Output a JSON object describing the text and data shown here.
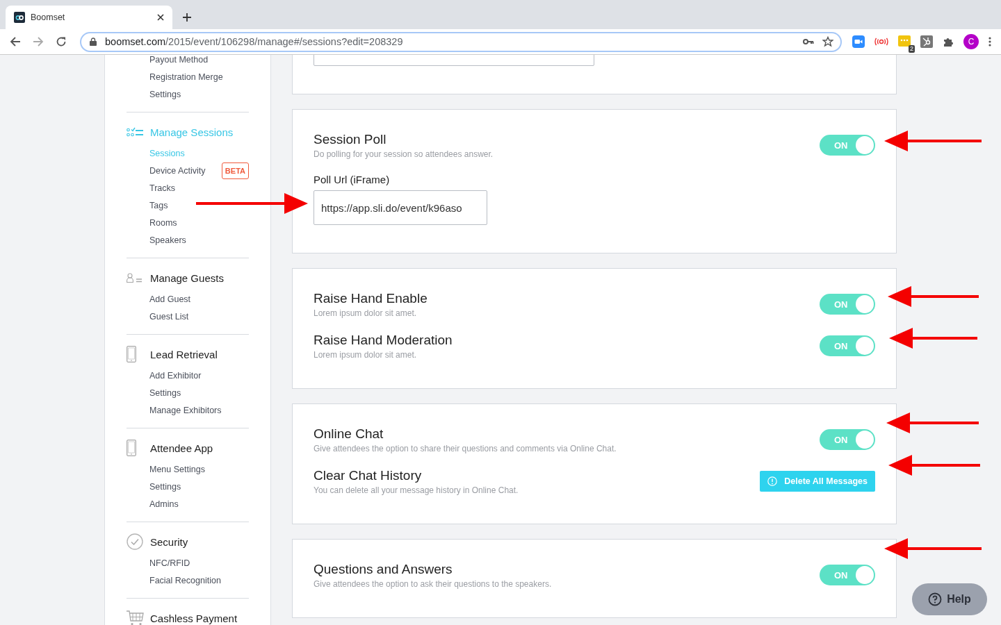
{
  "browser": {
    "tabs": [
      {
        "title": "Boomset",
        "selected": true
      }
    ],
    "address": {
      "host": "boomset.com",
      "path": "/2015/event/106298/manage#/sessions?edit=208329"
    },
    "extension_badge": "2",
    "profile_initial": "C"
  },
  "sidebar": {
    "sections": [
      {
        "items": [
          {
            "label": "Payout Method",
            "selected": false
          },
          {
            "label": "Registration Merge",
            "selected": false
          },
          {
            "label": "Settings",
            "selected": false
          }
        ]
      },
      {
        "title": "Manage Sessions",
        "active": true,
        "items": [
          {
            "label": "Sessions",
            "selected": true
          },
          {
            "label": "Device Activity",
            "selected": false,
            "badge": "BETA"
          },
          {
            "label": "Tracks",
            "selected": false
          },
          {
            "label": "Tags",
            "selected": false
          },
          {
            "label": "Rooms",
            "selected": false
          },
          {
            "label": "Speakers",
            "selected": false
          }
        ]
      },
      {
        "title": "Manage Guests",
        "active": false,
        "items": [
          {
            "label": "Add Guest",
            "selected": false
          },
          {
            "label": "Guest List",
            "selected": false
          }
        ]
      },
      {
        "title": "Lead Retrieval",
        "active": false,
        "items": [
          {
            "label": "Add Exhibitor",
            "selected": false
          },
          {
            "label": "Settings",
            "selected": false
          },
          {
            "label": "Manage Exhibitors",
            "selected": false
          }
        ]
      },
      {
        "title": "Attendee App",
        "active": false,
        "items": [
          {
            "label": "Menu Settings",
            "selected": false
          },
          {
            "label": "Settings",
            "selected": false
          },
          {
            "label": "Admins",
            "selected": false
          }
        ]
      },
      {
        "title": "Security",
        "active": false,
        "items": [
          {
            "label": "NFC/RFID",
            "selected": false
          },
          {
            "label": "Facial Recognition",
            "selected": false
          }
        ]
      },
      {
        "title": "Cashless Payment",
        "active": false
      }
    ]
  },
  "cards": [
    {
      "rows": [
        {
          "kind": "field",
          "value": ""
        }
      ]
    },
    {
      "rows": [
        {
          "kind": "toggle",
          "title": "Session Poll",
          "description": "Do polling for your session so attendees answer.",
          "on": true,
          "label": "ON"
        },
        {
          "kind": "field",
          "label": "Poll Url (iFrame)",
          "value": "https://app.sli.do/event/k96aso"
        }
      ]
    },
    {
      "rows": [
        {
          "kind": "toggle",
          "title": "Raise Hand Enable",
          "description": "Lorem ipsum dolor sit amet.",
          "on": true,
          "label": "ON"
        },
        {
          "kind": "toggle",
          "title": "Raise Hand Moderation",
          "description": "Lorem ipsum dolor sit amet.",
          "on": true,
          "label": "ON"
        }
      ]
    },
    {
      "rows": [
        {
          "kind": "toggle",
          "title": "Online Chat",
          "description": "Give attendees the option to share their questions and comments via Online Chat.",
          "on": true,
          "label": "ON"
        },
        {
          "kind": "button",
          "title": "Clear Chat History",
          "description": "You can delete all your message history in Online Chat.",
          "button": "Delete All Messages"
        }
      ]
    },
    {
      "rows": [
        {
          "kind": "toggle",
          "title": "Questions and Answers",
          "description": "Give attendees the option to ask their questions to the speakers.",
          "on": true,
          "label": "ON"
        }
      ]
    }
  ],
  "help_button": "Help"
}
